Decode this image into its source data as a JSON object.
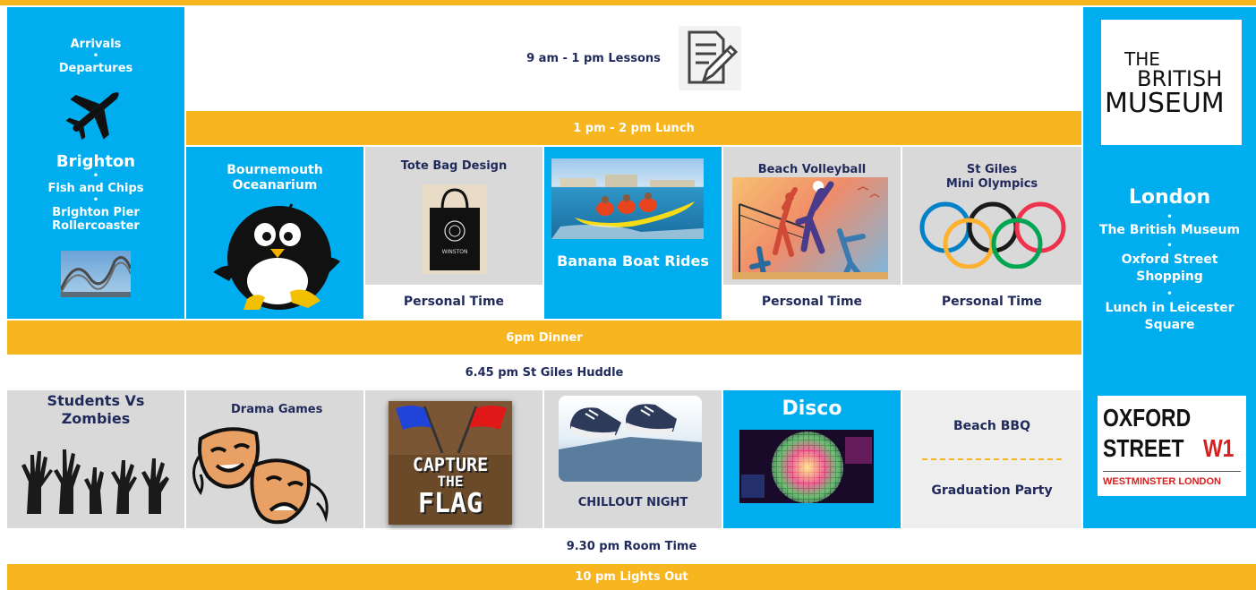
{
  "colors": {
    "blue": "#00adef",
    "yellow": "#f7b520",
    "grey": "#d9d9d9",
    "navy": "#1f2a5a",
    "red": "#d81e1e"
  },
  "left": {
    "arrivals": "Arrivals",
    "departures": "Departures",
    "plane_icon": "airplane-icon",
    "brighton": "Brighton",
    "fish": "Fish and Chips",
    "pier": "Brighton Pier Rollercoaster",
    "bullet": "•"
  },
  "lessons": "9 am - 1 pm  Lessons",
  "lunch": "1 pm - 2 pm  Lunch",
  "afternoon": {
    "bournemouth": "Bournemouth\nOceanarium",
    "tote": "Tote Bag Design",
    "tote_bag_text": "WINSTON",
    "banana": "Banana Boat Rides",
    "volleyball": "Beach Volleyball",
    "olympics": "St Giles\nMini Olympics",
    "personal": "Personal Time"
  },
  "dinner": "6pm Dinner",
  "huddle": "6.45 pm St Giles Huddle",
  "evening": {
    "zombies": "Students Vs\nZombies",
    "drama": "Drama Games",
    "ctf_line1": "CAPTURE",
    "ctf_line2": "THE",
    "ctf_line3": "FLAG",
    "chillout": "CHILLOUT NIGHT",
    "disco": "Disco",
    "bbq": "Beach BBQ",
    "graduation": "Graduation Party"
  },
  "room_time": "9.30 pm  Room Time",
  "lights_out": "10 pm  Lights Out",
  "right": {
    "museum_the": "THE",
    "museum_british": "BRITISH",
    "museum_museum": "MUSEUM",
    "london": "London",
    "british_museum": "The British Museum",
    "oxford_shopping": "Oxford Street\nShopping",
    "leicester": "Lunch in Leicester\nSquare",
    "bullet": "•",
    "sign_oxford": "OXFORD",
    "sign_street": "STREET",
    "sign_w1": "W1",
    "sign_westminster": "WESTMINSTER LONDON"
  }
}
